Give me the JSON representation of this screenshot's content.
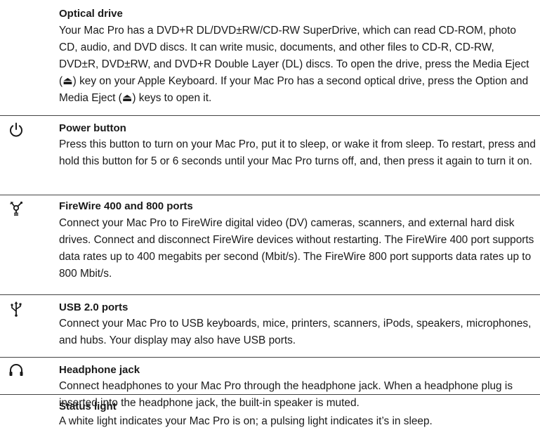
{
  "sections": [
    {
      "title": "Optical drive",
      "icon": "none",
      "body": "Your Mac Pro has a DVD+R DL/DVD±RW/CD-RW SuperDrive, which can read CD-ROM, photo CD, audio, and DVD discs. It can write music, documents, and other files to CD-R, CD-RW, DVD±R, DVD±RW, and DVD+R Double Layer (DL) discs. To open the drive, press the Media Eject (⏏) key on your Apple Keyboard. If your Mac Pro has a second optical drive, press the Option and Media Eject (⏏) keys to open it."
    },
    {
      "title": "Power button",
      "icon": "power-icon",
      "body": "Press this button to turn on your Mac Pro, put it to sleep, or wake it from sleep. To restart, press and hold this button for 5 or 6 seconds until your Mac Pro turns off, and, then press it again to turn it on."
    },
    {
      "title": "FireWire 400 and 800 ports",
      "icon": "firewire-icon",
      "body": "Connect your Mac Pro to FireWire digital video (DV) cameras, scanners, and external hard disk drives. Connect and disconnect FireWire devices without restarting. The FireWire 400 port supports data rates up to 400 megabits per second (Mbit/s). The FireWire 800 port supports data rates up to 800 Mbit/s."
    },
    {
      "title": "USB 2.0 ports",
      "icon": "usb-icon",
      "body": "Connect your Mac Pro to USB keyboards, mice, printers, scanners, iPods, speakers, microphones, and hubs. Your display may also have USB ports."
    },
    {
      "title": "Headphone jack",
      "icon": "headphone-icon",
      "body": "Connect headphones to your Mac Pro through the headphone jack. When a headphone plug is inserted into the headphone jack, the built-in speaker is muted."
    },
    {
      "title": "Status light",
      "icon": "none",
      "body": "A white light indicates your Mac Pro is on; a pulsing light indicates it’s in sleep."
    }
  ]
}
